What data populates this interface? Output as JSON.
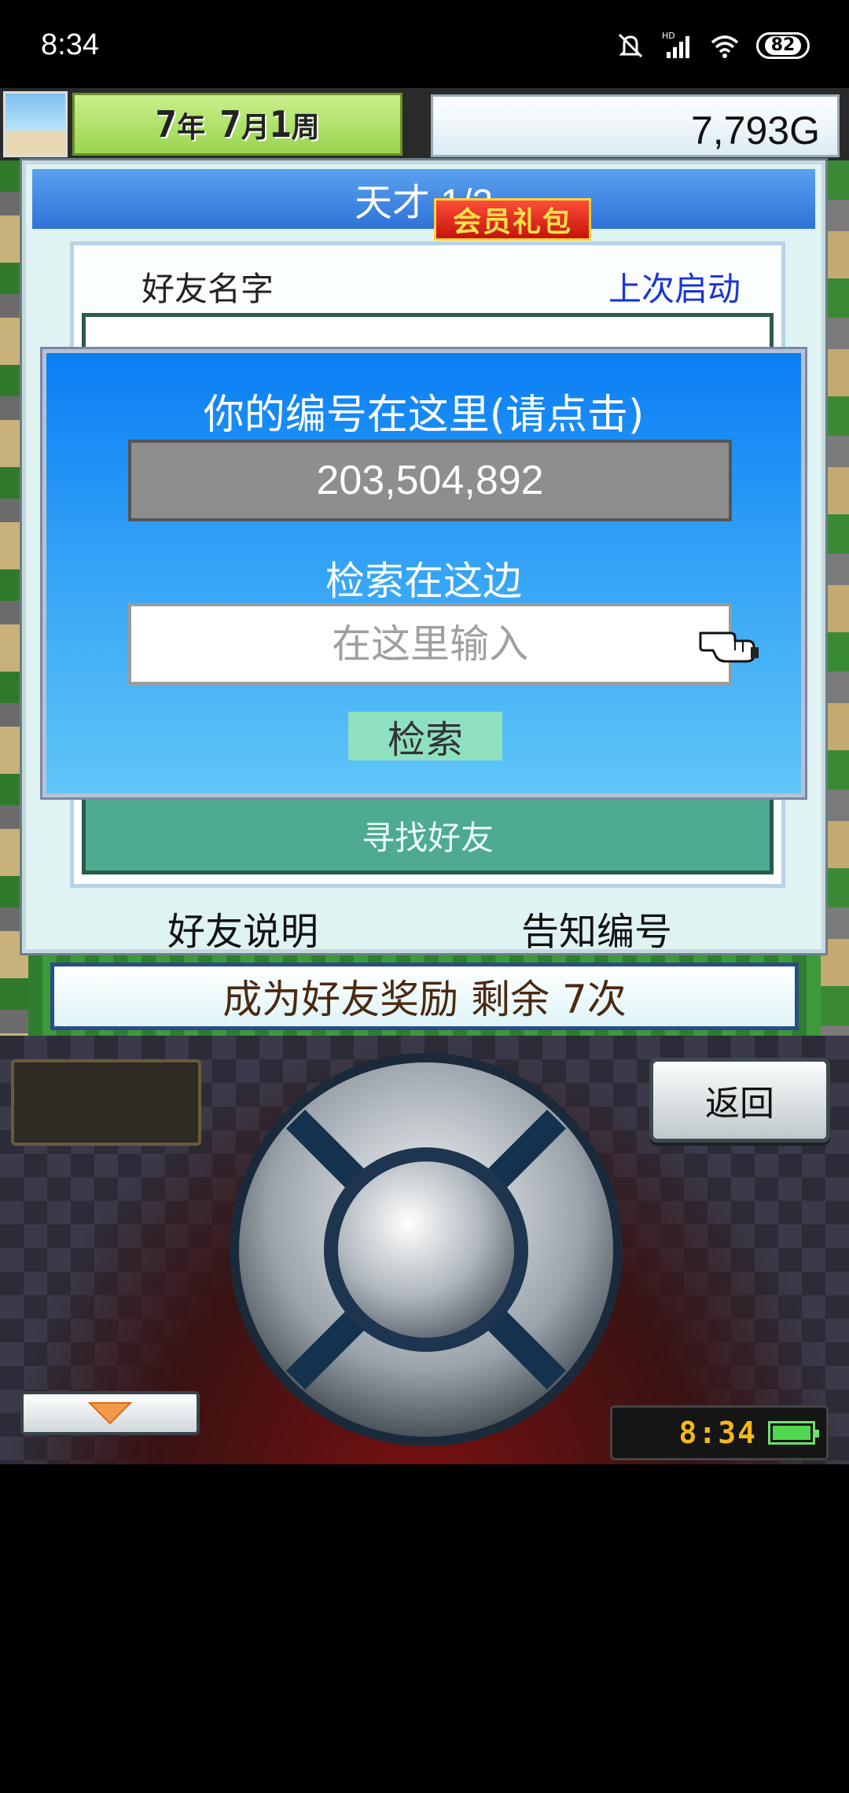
{
  "status_bar": {
    "time": "8:34",
    "network_label": "HD",
    "battery_level": "82",
    "icons": [
      "mute-icon",
      "signal-icon",
      "wifi-icon",
      "battery-icon"
    ]
  },
  "game_header": {
    "date": {
      "year": "7",
      "year_unit": "年",
      "month": "7",
      "month_unit": "月",
      "week": "1",
      "week_unit": "周"
    },
    "vip_pack_label": "会员礼包",
    "money": "7,793G"
  },
  "friends_panel": {
    "title": "天才 1/2",
    "col_friend_name": "好友名字",
    "col_last_launch": "上次启动",
    "find_friend_label": "寻找好友",
    "friend_help_label": "好友说明",
    "share_id_label": "告知编号"
  },
  "id_popup": {
    "title": "你的编号在这里(请点击)",
    "id_value": "203,504,892",
    "search_title": "检索在这边",
    "search_placeholder": "在这里输入",
    "search_button": "检索"
  },
  "bonus_bar": {
    "text": "成为好友奖励 剩余 7次"
  },
  "controller": {
    "back_button": "返回",
    "clock": "8:34"
  },
  "colors": {
    "popup_top": "#0a7ef5",
    "popup_bottom": "#5fc6f7",
    "panel_title": "#2f72d8",
    "find_friend": "#4eaa90",
    "search_button": "#8fe0c0",
    "last_launch_text": "#1a35d8"
  }
}
